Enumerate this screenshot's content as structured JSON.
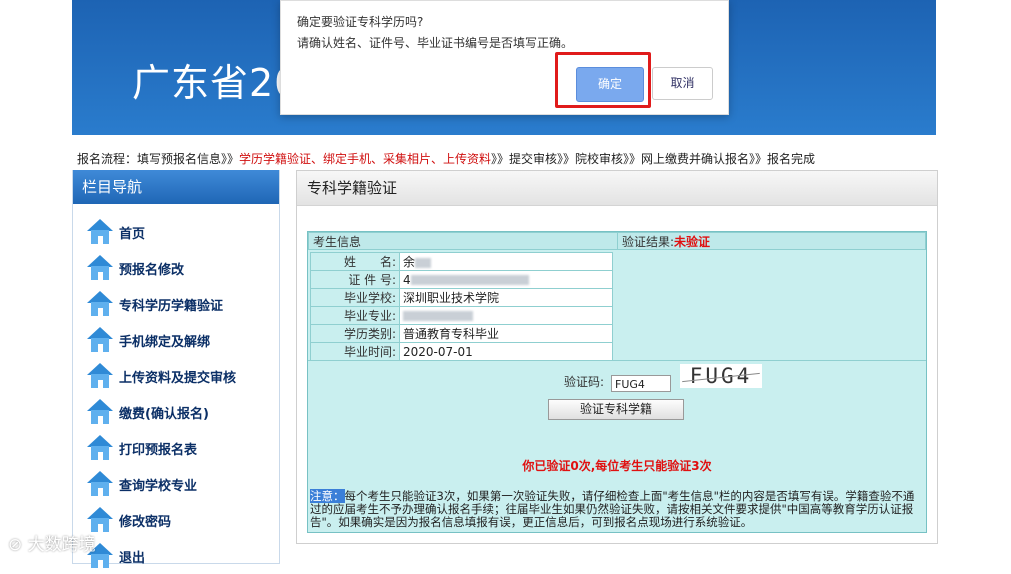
{
  "banner": {
    "title": "广东省20"
  },
  "flow": {
    "prefix": "报名流程：填写预报名信息》》",
    "highlight": "学历学籍验证、绑定手机、采集相片、上传资料",
    "suffix": "》》提交审核》》院校审核》》网上缴费并确认报名》》报名完成"
  },
  "nav": {
    "title": "栏目导航",
    "items": [
      {
        "label": "首页",
        "icon": "home-icon"
      },
      {
        "label": "预报名修改",
        "icon": "home-icon"
      },
      {
        "label": "专科学历学籍验证",
        "icon": "home-icon"
      },
      {
        "label": "手机绑定及解绑",
        "icon": "home-icon"
      },
      {
        "label": "上传资料及提交审核",
        "icon": "home-icon"
      },
      {
        "label": "缴费(确认报名)",
        "icon": "home-icon"
      },
      {
        "label": "打印预报名表",
        "icon": "home-icon"
      },
      {
        "label": "查询学校专业",
        "icon": "home-icon"
      },
      {
        "label": "修改密码",
        "icon": "home-icon"
      },
      {
        "label": "退出",
        "icon": "home-icon"
      }
    ]
  },
  "panel": {
    "title": "专科学籍验证",
    "info_header": "考生信息",
    "result_label": "验证结果:",
    "result_value": "未验证",
    "fields": [
      {
        "label": "姓　　名:",
        "value": "余"
      },
      {
        "label": "证 件 号:",
        "value": "4"
      },
      {
        "label": "毕业学校:",
        "value": "深圳职业技术学院"
      },
      {
        "label": "毕业专业:",
        "value": ""
      },
      {
        "label": "学历类别:",
        "value": "普通教育专科毕业"
      },
      {
        "label": "毕业时间:",
        "value": "2020-07-01"
      }
    ],
    "vcode_label": "验证码:",
    "vcode_value": "FUG4",
    "captcha_text": "FUG4",
    "verify_button": "验证专科学籍",
    "count_message": "你已验证0次,每位考生只能验证3次",
    "note_label": "注意：",
    "note_text": "每个考生只能验证3次，如果第一次验证失败，请仔细检查上面\"考生信息\"栏的内容是否填写有误。学籍查验不通过的应届考生不予办理确认报名手续；往届毕业生如果仍然验证失败，请按相关文件要求提供\"中国高等教育学历认证报告\"。如果确实是因为报名信息填报有误，更正信息后，可到报名点现场进行系统验证。"
  },
  "dialog": {
    "line1": "确定要验证专科学历吗?",
    "line2": "请确认姓名、证件号、毕业证书编号是否填写正确。",
    "ok_label": "确定",
    "cancel_label": "取消"
  },
  "watermark": {
    "text": "大数跨境"
  },
  "colors": {
    "accent": "#2a7ccd",
    "alert": "#e01010",
    "highlight_box": "#e01b1b"
  }
}
